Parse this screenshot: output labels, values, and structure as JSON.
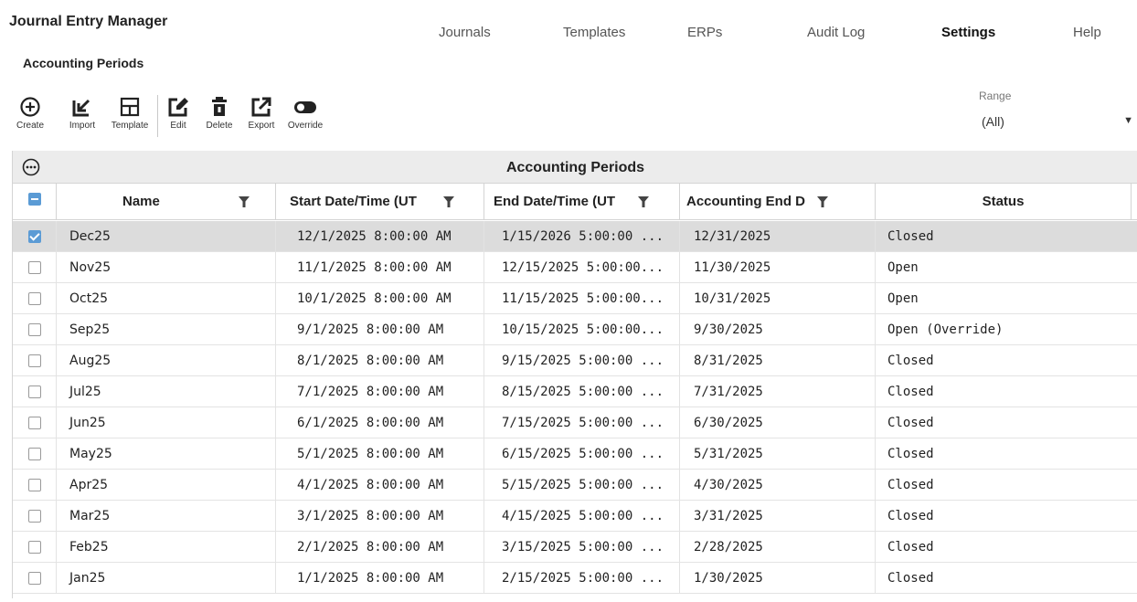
{
  "app": {
    "title": "Journal Entry Manager",
    "page_title": "Accounting Periods"
  },
  "nav": {
    "items": [
      {
        "label": "Journals"
      },
      {
        "label": "Templates"
      },
      {
        "label": "ERPs"
      },
      {
        "label": "Audit Log"
      },
      {
        "label": "Settings",
        "active": true
      },
      {
        "label": "Help"
      }
    ]
  },
  "toolbar": {
    "create": {
      "label": "Create",
      "icon": "plus-circle-icon"
    },
    "import": {
      "label": "Import",
      "icon": "import-arrow-icon"
    },
    "template": {
      "label": "Template",
      "icon": "template-grid-icon"
    },
    "edit": {
      "label": "Edit",
      "icon": "edit-pencil-icon"
    },
    "delete": {
      "label": "Delete",
      "icon": "trash-icon"
    },
    "export": {
      "label": "Export",
      "icon": "export-arrow-icon"
    },
    "override": {
      "label": "Override",
      "icon": "toggle-icon"
    }
  },
  "range": {
    "label": "Range",
    "value": "(All)"
  },
  "grid": {
    "caption": "Accounting Periods",
    "columns": [
      {
        "label": "Name",
        "filter": true
      },
      {
        "label": "Start Date/Time (UT",
        "filter": true
      },
      {
        "label": "End Date/Time (UT",
        "filter": true
      },
      {
        "label": "Accounting End D",
        "filter": true
      },
      {
        "label": "Status",
        "filter": false
      }
    ],
    "rows": [
      {
        "checked": true,
        "name": "Dec25",
        "start": "12/1/2025 8:00:00 AM",
        "end": "1/15/2026 5:00:00 ...",
        "acct_end": "12/31/2025",
        "status": "Closed"
      },
      {
        "checked": false,
        "name": "Nov25",
        "start": "11/1/2025 8:00:00 AM",
        "end": "12/15/2025 5:00:00...",
        "acct_end": "11/30/2025",
        "status": "Open"
      },
      {
        "checked": false,
        "name": "Oct25",
        "start": "10/1/2025 8:00:00 AM",
        "end": "11/15/2025 5:00:00...",
        "acct_end": "10/31/2025",
        "status": "Open"
      },
      {
        "checked": false,
        "name": "Sep25",
        "start": "9/1/2025 8:00:00 AM",
        "end": "10/15/2025 5:00:00...",
        "acct_end": "9/30/2025",
        "status": "Open (Override)"
      },
      {
        "checked": false,
        "name": "Aug25",
        "start": "8/1/2025 8:00:00 AM",
        "end": "9/15/2025 5:00:00 ...",
        "acct_end": "8/31/2025",
        "status": "Closed"
      },
      {
        "checked": false,
        "name": "Jul25",
        "start": "7/1/2025 8:00:00 AM",
        "end": "8/15/2025 5:00:00 ...",
        "acct_end": "7/31/2025",
        "status": "Closed"
      },
      {
        "checked": false,
        "name": "Jun25",
        "start": "6/1/2025 8:00:00 AM",
        "end": "7/15/2025 5:00:00 ...",
        "acct_end": "6/30/2025",
        "status": "Closed"
      },
      {
        "checked": false,
        "name": "May25",
        "start": "5/1/2025 8:00:00 AM",
        "end": "6/15/2025 5:00:00 ...",
        "acct_end": "5/31/2025",
        "status": "Closed"
      },
      {
        "checked": false,
        "name": "Apr25",
        "start": "4/1/2025 8:00:00 AM",
        "end": "5/15/2025 5:00:00 ...",
        "acct_end": "4/30/2025",
        "status": "Closed"
      },
      {
        "checked": false,
        "name": "Mar25",
        "start": "3/1/2025 8:00:00 AM",
        "end": "4/15/2025 5:00:00 ...",
        "acct_end": "3/31/2025",
        "status": "Closed"
      },
      {
        "checked": false,
        "name": "Feb25",
        "start": "2/1/2025 8:00:00 AM",
        "end": "3/15/2025 5:00:00 ...",
        "acct_end": "2/28/2025",
        "status": "Closed"
      },
      {
        "checked": false,
        "name": "Jan25",
        "start": "1/1/2025 8:00:00 AM",
        "end": "2/15/2025 5:00:00 ...",
        "acct_end": "1/30/2025",
        "status": "Closed"
      }
    ]
  }
}
